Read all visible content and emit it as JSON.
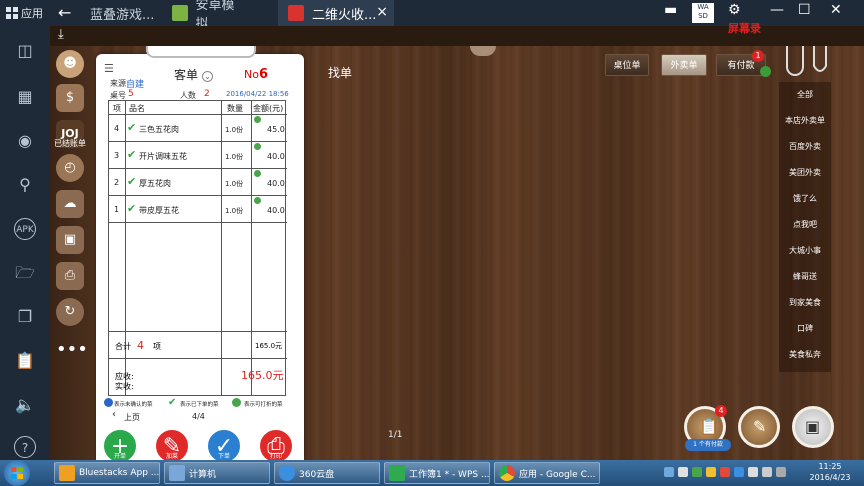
{
  "titlebar": {
    "app_label": "应用",
    "tabs": [
      {
        "label": "蓝叠游戏..."
      },
      {
        "label": "安卓模拟..."
      },
      {
        "label": "二维火收..."
      }
    ],
    "watermark": "屏幕录"
  },
  "receipt": {
    "title": "客单",
    "no_label": "No",
    "no_value": "6",
    "source_label": "来源",
    "source_value": "自建",
    "table_label": "桌号",
    "table_value": "5",
    "people_label": "人数",
    "people_value": "2",
    "datetime": "2016/04/22 18:56",
    "columns": [
      "项",
      "品名",
      "数量",
      "金额(元)"
    ],
    "items": [
      {
        "idx": "4",
        "name": "三色五花肉",
        "qty": "1.0份",
        "amount": "45.0"
      },
      {
        "idx": "3",
        "name": "开片调味五花",
        "qty": "1.0份",
        "amount": "40.0"
      },
      {
        "idx": "2",
        "name": "厚五花肉",
        "qty": "1.0份",
        "amount": "40.0"
      },
      {
        "idx": "1",
        "name": "带皮厚五花",
        "qty": "1.0份",
        "amount": "40.0"
      }
    ],
    "total_label": "合计",
    "total_count": "4",
    "total_unit": "项",
    "total_amount": "165.0元",
    "due_label": "应收:",
    "due_amount": "165.0元",
    "paid_label": "实收:",
    "legend": [
      "表示未确认的菜",
      "表示已下单的菜",
      "表示可打折的菜"
    ],
    "prev_label": "上页",
    "page_info": "4/4",
    "buttons": [
      {
        "label": "开单",
        "color": "#2aa84a"
      },
      {
        "label": "加菜",
        "color": "#e02a2a"
      },
      {
        "label": "下单",
        "color": "#2a7fd0"
      },
      {
        "label": "打印",
        "color": "#e02a2a"
      }
    ]
  },
  "sidebar": {
    "settled_label": "已结账单"
  },
  "main": {
    "find_label": "找单",
    "top_buttons": [
      {
        "label": "桌位单"
      },
      {
        "label": "外卖单"
      },
      {
        "label": "有付款"
      }
    ],
    "badge_count": "1",
    "filters": [
      "全部",
      "本店外卖单",
      "百度外卖",
      "美团外卖",
      "饿了么",
      "点我吧",
      "大城小事",
      "蜂哥送",
      "到家美食",
      "口碑",
      "美食私奔"
    ],
    "page_indicator": "1/1",
    "corner_badge": "4",
    "corner_pill": "1 个有付款"
  },
  "taskbar": {
    "items": [
      {
        "label": "Bluestacks App ...",
        "color": "#f0a020"
      },
      {
        "label": "计算机",
        "color": "#7aa7d8"
      },
      {
        "label": "360云盘",
        "color": "#3b8fe0"
      },
      {
        "label": "工作簿1 * - WPS ...",
        "color": "#2faa4f"
      },
      {
        "label": "应用 - Google C...",
        "color": "#e04a3a"
      }
    ],
    "time": "11:25",
    "date": "2016/4/23"
  }
}
